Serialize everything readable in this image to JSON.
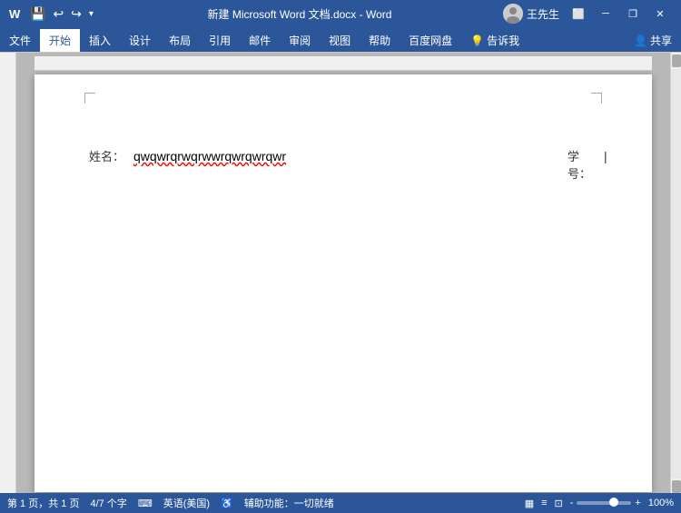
{
  "titlebar": {
    "title": "新建 Microsoft Word 文档.docx - Word",
    "user": "王先生",
    "quick_access": [
      "save",
      "undo",
      "redo",
      "customize"
    ],
    "win_btns": [
      "minimize",
      "restore",
      "close"
    ]
  },
  "ribbon": {
    "tabs": [
      "文件",
      "开始",
      "插入",
      "设计",
      "布局",
      "引用",
      "邮件",
      "审阅",
      "视图",
      "帮助",
      "百度网盘",
      "告诉我"
    ],
    "active_tab": "开始",
    "share_label": "共享"
  },
  "document": {
    "name_label": "姓名：",
    "name_value": "qwqwrqrwqrwwrqwrqwrqwr",
    "student_id_label": "学号："
  },
  "statusbar": {
    "page_info": "第 1 页，共 1 页",
    "word_count": "4/7 个字",
    "language": "英语(美国)",
    "accessibility": "辅助功能：一切就绪",
    "zoom_percent": "100%",
    "zoom_minus": "-",
    "zoom_plus": "+"
  },
  "icons": {
    "save": "💾",
    "undo": "↩",
    "redo": "↪",
    "customize": "▾",
    "minimize": "─",
    "restore": "❐",
    "close": "✕",
    "word_icon": "W",
    "layout_icon": "▦",
    "view_icon": "≡",
    "zoom_icon": "🔍",
    "share_icon": "👤",
    "lang_icon": "⌨"
  }
}
